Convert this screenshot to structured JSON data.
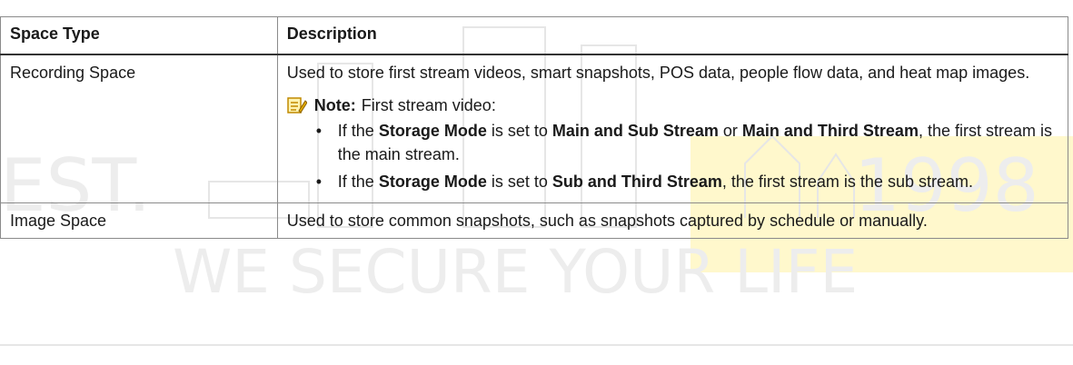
{
  "top_text": "Image Space Recording Space",
  "table": {
    "headers": [
      "Space Type",
      "Description"
    ],
    "rows": [
      {
        "type": "Recording Space",
        "description": "Used to store first stream videos, smart snapshots, POS data, people flow data, and heat map images.",
        "note": {
          "label": "Note:",
          "text": "First stream video:",
          "items": [
            {
              "parts": [
                {
                  "t": "If the ",
                  "b": false
                },
                {
                  "t": "Storage Mode",
                  "b": true
                },
                {
                  "t": " is set to ",
                  "b": false
                },
                {
                  "t": "Main and Sub Stream",
                  "b": true
                },
                {
                  "t": " or ",
                  "b": false
                },
                {
                  "t": "Main and Third Stream",
                  "b": true
                },
                {
                  "t": ", the first stream is the main stream.",
                  "b": false
                }
              ]
            },
            {
              "parts": [
                {
                  "t": "If the ",
                  "b": false
                },
                {
                  "t": "Storage Mode",
                  "b": true
                },
                {
                  "t": " is set to ",
                  "b": false
                },
                {
                  "t": "Sub and Third Stream",
                  "b": true
                },
                {
                  "t": ", the first stream is the sub stream.",
                  "b": false
                }
              ]
            }
          ]
        }
      },
      {
        "type": "Image Space",
        "description": "Used to store common snapshots, such as snapshots captured by schedule or manually."
      }
    ]
  },
  "watermark": {
    "left_text": "EST.",
    "year": "1998",
    "slogan": "WE SECURE YOUR LIFE"
  },
  "colors": {
    "border": "#8a8a8a",
    "watermark": "#ededed",
    "highlight": "#fff8cc",
    "note_icon": "#e0a800"
  },
  "icons": [
    "note-icon"
  ]
}
